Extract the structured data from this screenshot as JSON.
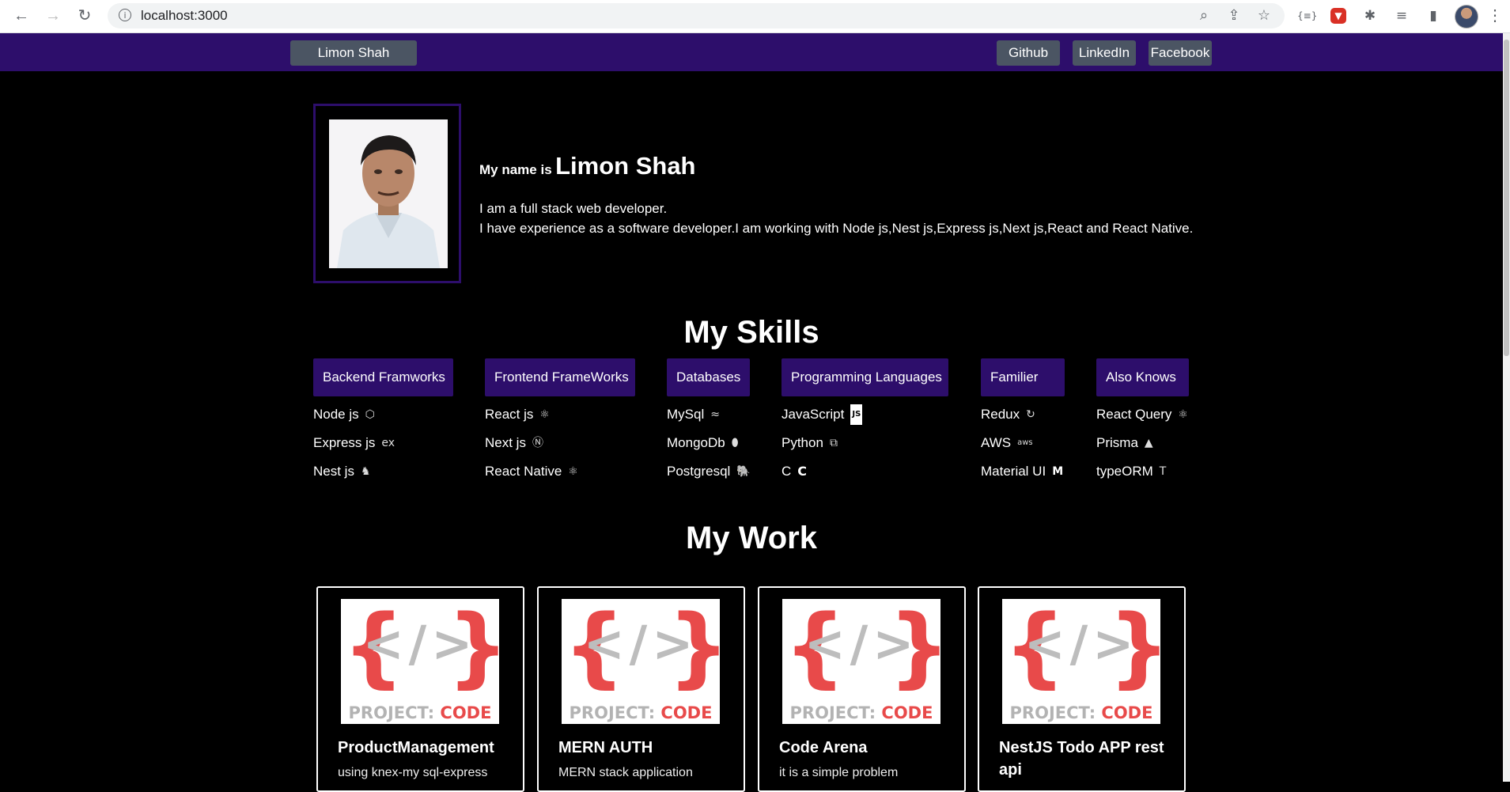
{
  "browser": {
    "url": "localhost:3000",
    "back_icon": "←",
    "forward_icon": "→",
    "reload_icon": "↻",
    "info_icon": "i",
    "zoom_icon": "⌕",
    "share_icon": "⇪",
    "star_icon": "☆",
    "menu_icon": "⋮"
  },
  "navbar": {
    "brand": "Limon Shah",
    "links": [
      "Github",
      "LinkedIn",
      "Facebook"
    ]
  },
  "hero": {
    "prefix": "My name is",
    "name": "Limon Shah",
    "line1": "I am a full stack web developer.",
    "line2": "I have experience as a software developer.I am working with Node js,Nest js,Express js,Next js,React and React Native."
  },
  "skills": {
    "title": "My Skills",
    "columns": [
      {
        "heading": "Backend Framworks",
        "items": [
          {
            "label": "Node js",
            "icon": "⬡"
          },
          {
            "label": "Express js",
            "icon": "ex"
          },
          {
            "label": "Nest js",
            "icon": "♞"
          }
        ]
      },
      {
        "heading": "Frontend FrameWorks",
        "items": [
          {
            "label": "React js",
            "icon": "⚛"
          },
          {
            "label": "Next js",
            "icon": "Ⓝ"
          },
          {
            "label": "React Native",
            "icon": "⚛"
          }
        ]
      },
      {
        "heading": "Databases",
        "items": [
          {
            "label": "MySql",
            "icon": "≈"
          },
          {
            "label": "MongoDb",
            "icon": "⬮"
          },
          {
            "label": "Postgresql",
            "icon": "🐘"
          }
        ]
      },
      {
        "heading": "Programming Languages",
        "items": [
          {
            "label": "JavaScript",
            "icon": "JS"
          },
          {
            "label": "Python",
            "icon": "⧉"
          },
          {
            "label": "C",
            "icon": "C"
          }
        ]
      },
      {
        "heading": "Familier",
        "items": [
          {
            "label": "Redux",
            "icon": "↻"
          },
          {
            "label": "AWS",
            "icon": "aws"
          },
          {
            "label": "Material UI",
            "icon": "M"
          }
        ]
      },
      {
        "heading": "Also Knows",
        "items": [
          {
            "label": "React Query",
            "icon": "⚛"
          },
          {
            "label": "Prisma",
            "icon": "▲"
          },
          {
            "label": "typeORM",
            "icon": "T"
          }
        ]
      }
    ]
  },
  "work": {
    "title": "My Work",
    "thumb_left_word": "PROJECT:",
    "thumb_right_word": "CODE",
    "thumb_symbol": "</>",
    "projects": [
      {
        "title": "ProductManagement",
        "desc": "using knex-my sql-express"
      },
      {
        "title": "MERN AUTH",
        "desc": "MERN stack application"
      },
      {
        "title": "Code Arena",
        "desc": "it is a simple problem"
      },
      {
        "title": "NestJS Todo APP rest api",
        "desc": ""
      }
    ]
  },
  "colors": {
    "navbar": "#2d0e6b",
    "button": "#4b5563",
    "accent_red": "#e84a4a"
  }
}
